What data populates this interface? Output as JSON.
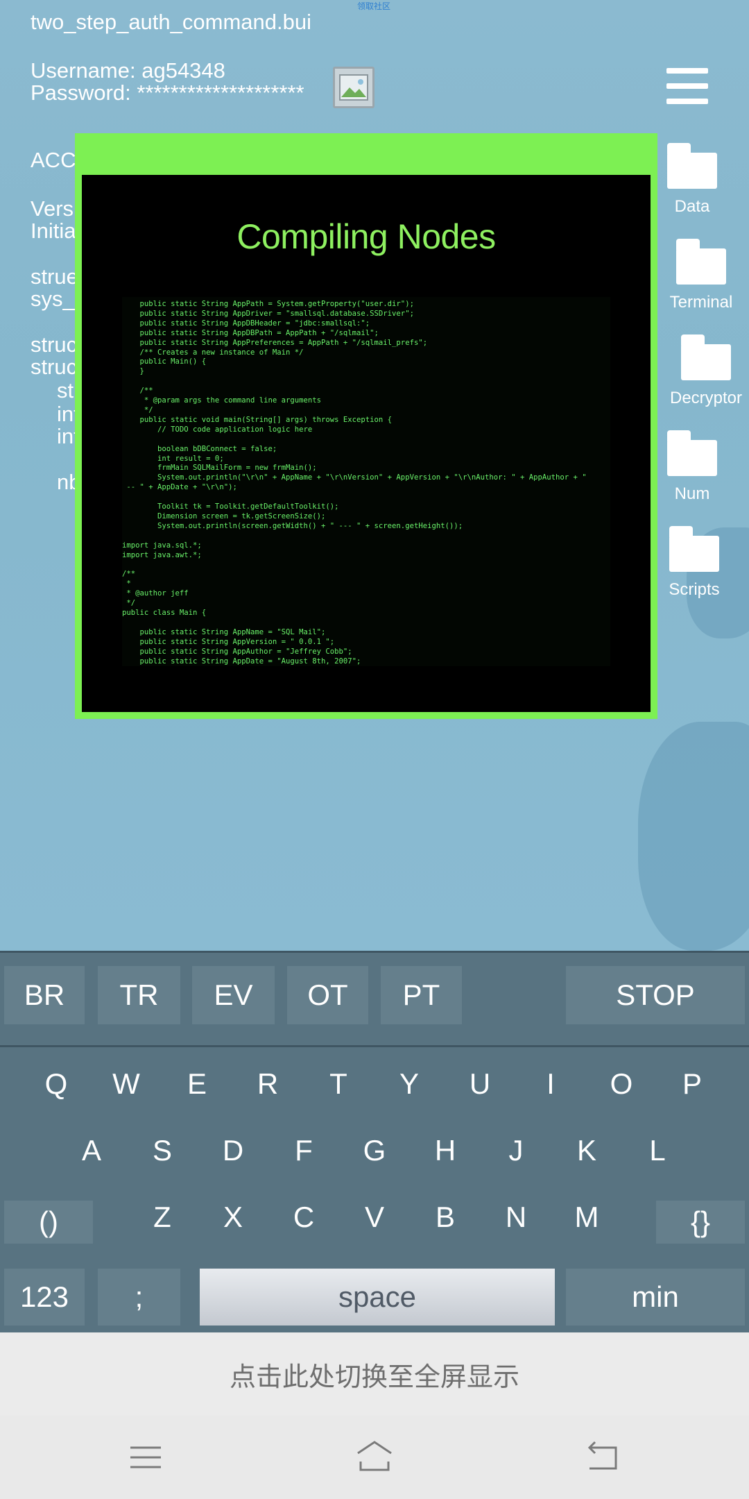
{
  "notice": "领取社区",
  "desktop": {
    "file_title": "two_step_auth_command.bui",
    "username_line": "Username: ag54348",
    "password_line": "Password: ********************",
    "background_text": [
      "ACC",
      "Versi",
      "Initia",
      "strue",
      "sys_",
      "struc",
      "struc",
      "st",
      "int",
      "int",
      "nb"
    ],
    "icons": [
      {
        "label": "Data",
        "icon": "folder-icon"
      },
      {
        "label": "Terminal",
        "icon": "folder-icon"
      },
      {
        "label": "Decryptor",
        "icon": "folder-icon"
      },
      {
        "label": "Num",
        "icon": "folder-icon"
      },
      {
        "label": "Scripts",
        "icon": "folder-icon"
      }
    ]
  },
  "modal": {
    "title": "Compiling Nodes",
    "code_lines": [
      "    public static String AppPath = System.getProperty(\"user.dir\");",
      "    public static String AppDriver = \"smallsql.database.SSDriver\";",
      "    public static String AppDBHeader = \"jdbc:smallsql:\";",
      "    public static String AppDBPath = AppPath + \"/sqlmail\";",
      "    public static String AppPreferences = AppPath + \"/sqlmail_prefs\";",
      "    /** Creates a new instance of Main */",
      "    public Main() {",
      "    }",
      "",
      "    /**",
      "     * @param args the command line arguments",
      "     */",
      "    public static void main(String[] args) throws Exception {",
      "        // TODO code application logic here",
      "",
      "        boolean bDBConnect = false;",
      "        int result = 0;",
      "        frmMain SQLMailForm = new frmMain();",
      "        System.out.println(\"\\r\\n\" + AppName + \"\\r\\nVersion\" + AppVersion + \"\\r\\nAuthor: \" + AppAuthor + \"",
      " -- \" + AppDate + \"\\r\\n\");",
      "",
      "        Toolkit tk = Toolkit.getDefaultToolkit();",
      "        Dimension screen = tk.getScreenSize();",
      "        System.out.println(screen.getWidth() + \" --- \" + screen.getHeight());",
      "",
      "import java.sql.*;",
      "import java.awt.*;",
      "",
      "/**",
      " *",
      " * @author jeff",
      " */",
      "public class Main {",
      "",
      "    public static String AppName = \"SQL Mail\";",
      "    public static String AppVersion = \" 0.0.1 \";",
      "    public static String AppAuthor = \"Jeffrey Cobb\";",
      "    public static String AppDate = \"August 8th, 2007\";"
    ]
  },
  "keyboard": {
    "command_keys": [
      "BR",
      "TR",
      "EV",
      "OT",
      "PT"
    ],
    "stop": "STOP",
    "row1": [
      "Q",
      "W",
      "E",
      "R",
      "T",
      "Y",
      "U",
      "I",
      "O",
      "P"
    ],
    "row2": [
      "A",
      "S",
      "D",
      "F",
      "G",
      "H",
      "J",
      "K",
      "L"
    ],
    "row3": [
      "Z",
      "X",
      "C",
      "V",
      "B",
      "N",
      "M"
    ],
    "paren": "()",
    "brace": "{}",
    "num": "123",
    "semicolon": ";",
    "space": "space",
    "min": "min"
  },
  "fullscreen_hint": "点击此处切换至全屏显示",
  "nav": {
    "menu_icon": "menu-icon",
    "home_icon": "home-icon",
    "back_icon": "back-icon"
  },
  "colors": {
    "modal_frame": "#7df053",
    "terminal_text": "#6af26a",
    "keyboard_bg": "#587381"
  }
}
